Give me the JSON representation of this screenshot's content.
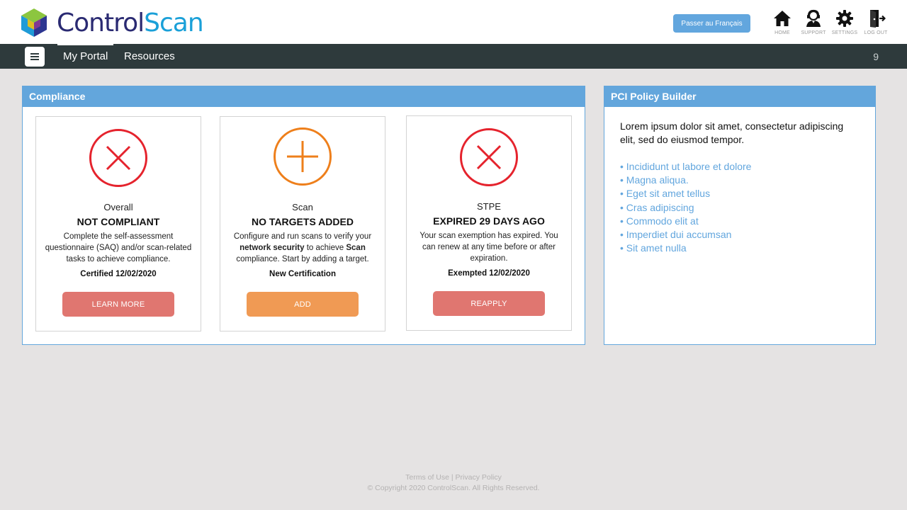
{
  "header": {
    "logo_text_a": "Control",
    "logo_text_b": "Scan",
    "language_button": "Passer au Français",
    "icons": [
      {
        "name": "home-icon",
        "label": "HOME"
      },
      {
        "name": "support-icon",
        "label": "SUPPORT"
      },
      {
        "name": "settings-icon",
        "label": "SETTINGS"
      },
      {
        "name": "logout-icon",
        "label": "LOG OUT"
      }
    ]
  },
  "nav": {
    "tabs": [
      {
        "label": "My Portal",
        "active": true
      },
      {
        "label": "Resources",
        "active": false
      }
    ],
    "count": "9"
  },
  "compliance": {
    "title": "Compliance",
    "cards": [
      {
        "icon": "x-circle-icon",
        "label": "Overall",
        "headline": "NOT COMPLIANT",
        "description": "Complete the self-assessment questionnaire (SAQ) and/or scan-related tasks to achieve compliance.",
        "date": "Certified 12/02/2020",
        "button": "LEARN  MORE",
        "color": "#e5232d"
      },
      {
        "icon": "plus-circle-icon",
        "label": "Scan",
        "headline": "NO TARGETS ADDED",
        "description_parts": [
          "Configure and run scans to verify your ",
          "network security",
          " to achieve ",
          "Scan",
          " compliance. Start by adding a target."
        ],
        "date": "New Certification",
        "button": "ADD",
        "color": "#ee7f1b"
      },
      {
        "icon": "x-circle-icon",
        "label": "STPE",
        "headline": "EXPIRED 29 DAYS AGO",
        "description": "Your scan exemption has expired. You can renew at any time before or after expiration.",
        "date": "Exempted 12/02/2020",
        "button": "REAPPLY",
        "color": "#e5232d"
      }
    ]
  },
  "policy": {
    "title": "PCI Policy Builder",
    "intro": "Lorem ipsum dolor sit amet, consectetur adipiscing elit, sed do eiusmod tempor.",
    "items": [
      "• Incididunt ut labore et dolore",
      "• Magna aliqua.",
      "• Eget sit amet tellus",
      "• Cras adipiscing",
      "• Commodo  elit at",
      "• Imperdiet dui accumsan",
      "• Sit amet nulla"
    ]
  },
  "footer": {
    "terms": "Terms of Use",
    "separator": " | ",
    "privacy": "Privacy Policy",
    "copyright": "© Copyright 2020 ControlScan. All Rights Reserved."
  },
  "colors": {
    "accent_blue": "#63a6dc",
    "nav_dark": "#2e3a3c",
    "fail_red": "#e5232d",
    "warn_orange": "#ee7f1b"
  }
}
